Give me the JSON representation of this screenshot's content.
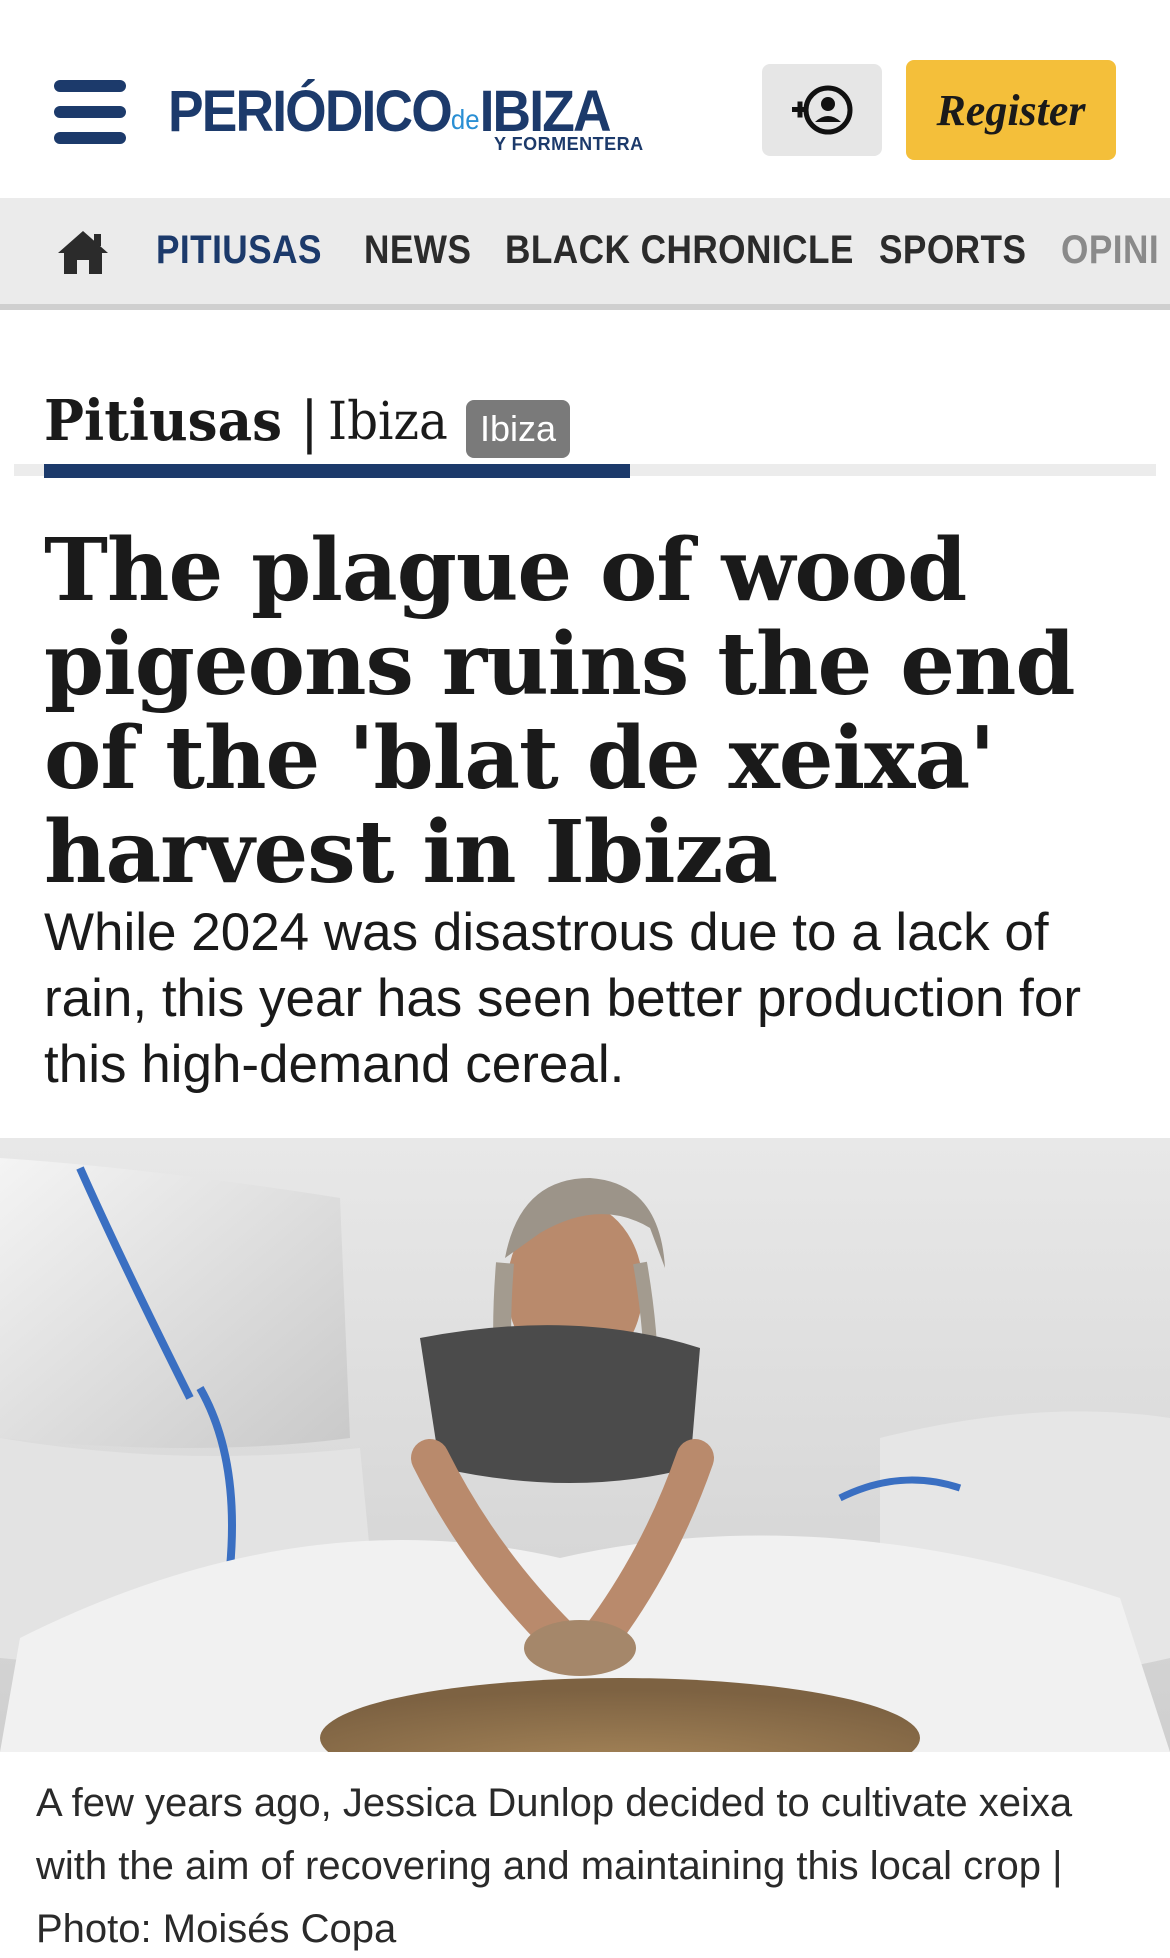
{
  "header": {
    "logo": {
      "main_part1": "PERIÓDICO",
      "main_de": "de",
      "main_part2": "IBIZA",
      "sub": "Y FORMENTERA"
    },
    "login_icon": "user-plus-icon",
    "register_label": "Register"
  },
  "nav": {
    "home_icon": "home-icon",
    "items": [
      {
        "label": "PITIUSAS",
        "active": true
      },
      {
        "label": "NEWS",
        "active": false
      },
      {
        "label": "BLACK CHRONICLE",
        "active": false
      },
      {
        "label": "SPORTS",
        "active": false
      },
      {
        "label": "OPINI",
        "active": false
      }
    ]
  },
  "section": {
    "title": "Pitiusas",
    "separator": "|",
    "subsection": "Ibiza",
    "badge": "Ibiza"
  },
  "article": {
    "headline": "The plague of wood pigeons ruins the end of the 'blat de xeixa' harvest in Ibiza",
    "subheadline": "While 2024 was disastrous due to a lack of rain, this year has seen better production for this high-demand cereal.",
    "photo_caption": "A few years ago, Jessica Dunlop decided to cultivate xeixa with the aim of recovering and maintaining this local crop | Photo: Moisés Copa"
  },
  "colors": {
    "brand_navy": "#1c3a6b",
    "brand_light_blue": "#2a8fd4",
    "register_yellow": "#f4bf3a",
    "nav_background": "#ebebeb",
    "badge_grey": "#7a7a7a"
  }
}
